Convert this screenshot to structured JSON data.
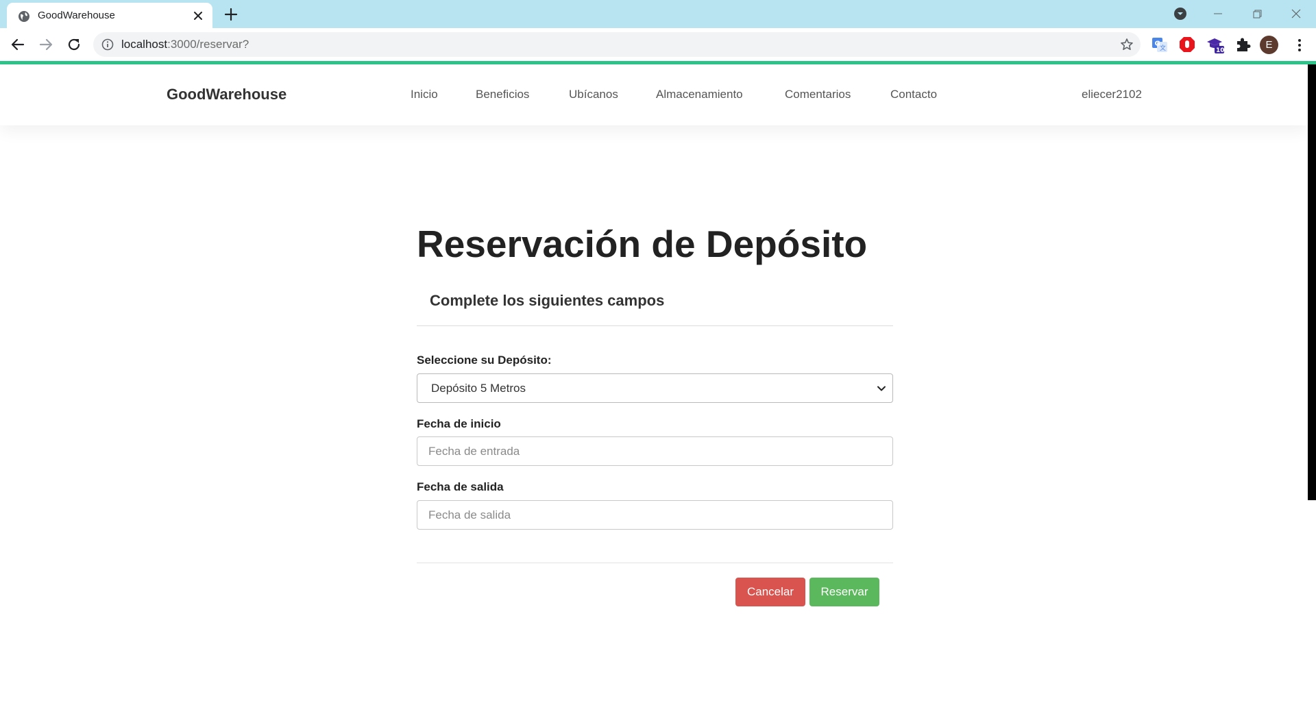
{
  "browser": {
    "tab_title": "GoodWarehouse",
    "url_host": "localhost",
    "url_path": ":3000/reservar?",
    "profile_initial": "E",
    "extension_badge": "10",
    "colors": {
      "tabstrip": "#b7e4f0",
      "accent_bar": "#2ec58a"
    }
  },
  "site": {
    "brand": "GoodWarehouse",
    "menu": [
      {
        "label": "Inicio"
      },
      {
        "label": "Beneficios"
      },
      {
        "label": "Ubícanos"
      },
      {
        "label": "Almacenamiento"
      },
      {
        "label": "Comentarios"
      },
      {
        "label": "Contacto"
      }
    ],
    "username": "eliecer2102"
  },
  "form": {
    "title": "Reservación de Depósito",
    "subtitle": "Complete los siguientes campos",
    "deposit": {
      "label": "Seleccione su Depósito:",
      "value": "Depósito 5 Metros"
    },
    "start_date": {
      "label": "Fecha de inicio",
      "placeholder": "Fecha de entrada",
      "value": ""
    },
    "end_date": {
      "label": "Fecha de salida",
      "placeholder": "Fecha de salida",
      "value": ""
    },
    "cancel_label": "Cancelar",
    "reserve_label": "Reservar",
    "colors": {
      "cancel": "#d9534f",
      "reserve": "#5cb85c"
    }
  }
}
